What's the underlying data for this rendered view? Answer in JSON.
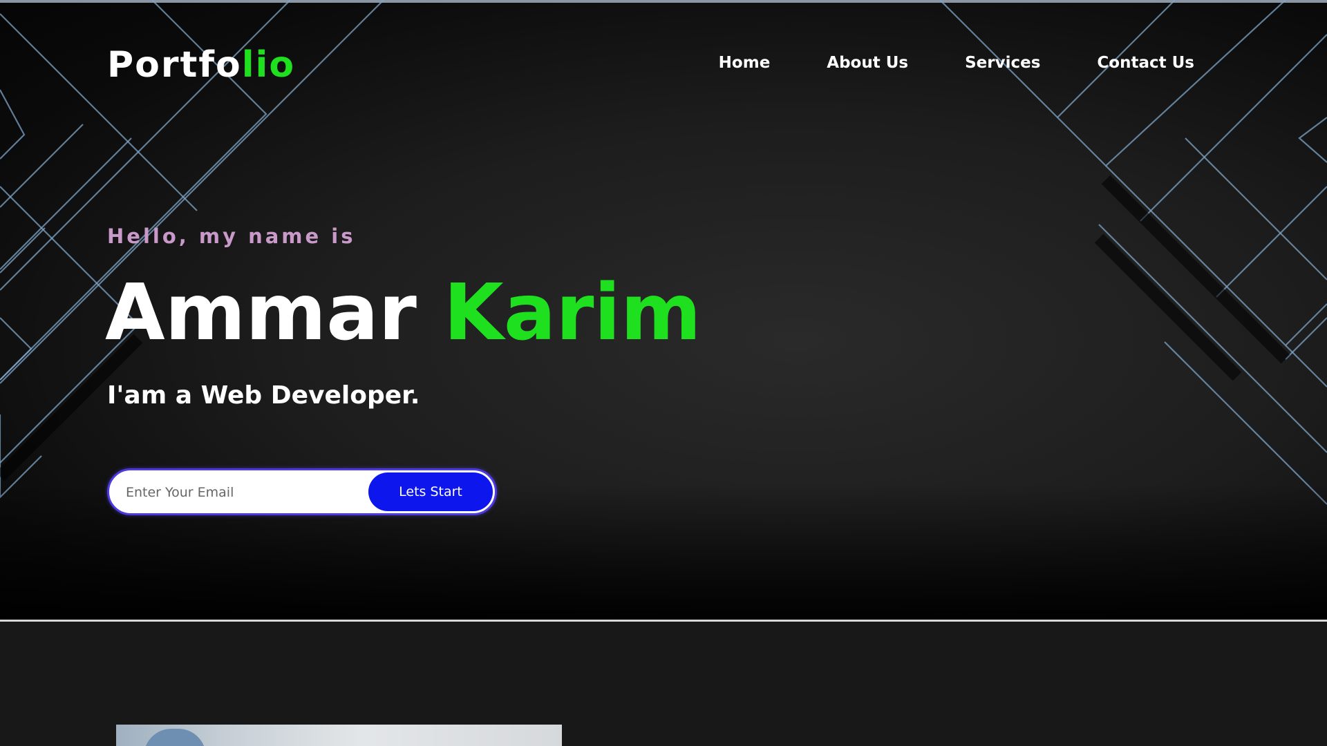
{
  "logo": {
    "main": "Portfo",
    "accent": "lio"
  },
  "nav": {
    "items": [
      "Home",
      "About Us",
      "Services",
      "Contact Us"
    ]
  },
  "hero": {
    "greeting": "Hello, my name is",
    "first_name": "Ammar",
    "last_name": "Karim",
    "role": "I'am a Web Developer."
  },
  "subscribe": {
    "placeholder": "Enter Your Email",
    "value": "",
    "button_label": "Lets Start"
  },
  "colors": {
    "accent_green": "#1ee01e",
    "greeting_pink": "#c99ac9",
    "button_blue": "#0e16ee",
    "border_purple": "#4a3adf",
    "background": "#181818"
  }
}
